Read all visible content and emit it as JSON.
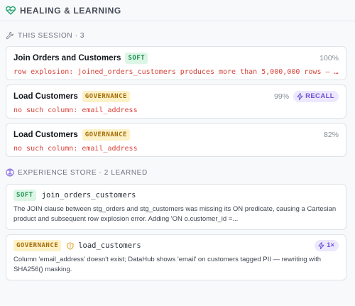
{
  "header": {
    "title": "HEALING & LEARNING",
    "icon": "heart-pulse-icon",
    "accent": "#22a06b"
  },
  "session": {
    "label": "THIS SESSION · 3",
    "icon": "wrench-icon",
    "runs": [
      {
        "name": "Join Orders and Customers",
        "badge": "SOFT",
        "badge_kind": "soft",
        "confidence": "100%",
        "recall": null,
        "error": "row explosion: joined_orders_customers produces more than 5,000,000 rows — …"
      },
      {
        "name": "Load Customers",
        "badge": "GOVERNANCE",
        "badge_kind": "gov",
        "confidence": "99%",
        "recall": "RECALL",
        "error": "no such column: email_address"
      },
      {
        "name": "Load Customers",
        "badge": "GOVERNANCE",
        "badge_kind": "gov",
        "confidence": "82%",
        "recall": null,
        "error": "no such column: email_address"
      }
    ]
  },
  "experience": {
    "label": "EXPERIENCE STORE · 2 LEARNED",
    "icon": "brain-icon",
    "entries": [
      {
        "badge": "SOFT",
        "badge_kind": "soft",
        "key": "join_orders_customers",
        "count": null,
        "description": "The JOIN clause between stg_orders and stg_customers was missing its ON predicate, causing a Cartesian product and subsequent row explosion error. Adding 'ON o.customer_id =..."
      },
      {
        "badge": "GOVERNANCE",
        "badge_kind": "gov",
        "key": "load_customers",
        "count": "1×",
        "description": "Column 'email_address' doesn't exist; DataHub shows 'email' on customers tagged PII — rewriting with SHA256() masking."
      }
    ]
  },
  "colors": {
    "error": "#d8453d",
    "soft_bg": "#dcf6e6",
    "soft_fg": "#1e8f4e",
    "gov_bg": "#fdf1c7",
    "gov_fg": "#a36b06",
    "recall_bg": "#ece8fd",
    "recall_fg": "#6f4fd8"
  }
}
